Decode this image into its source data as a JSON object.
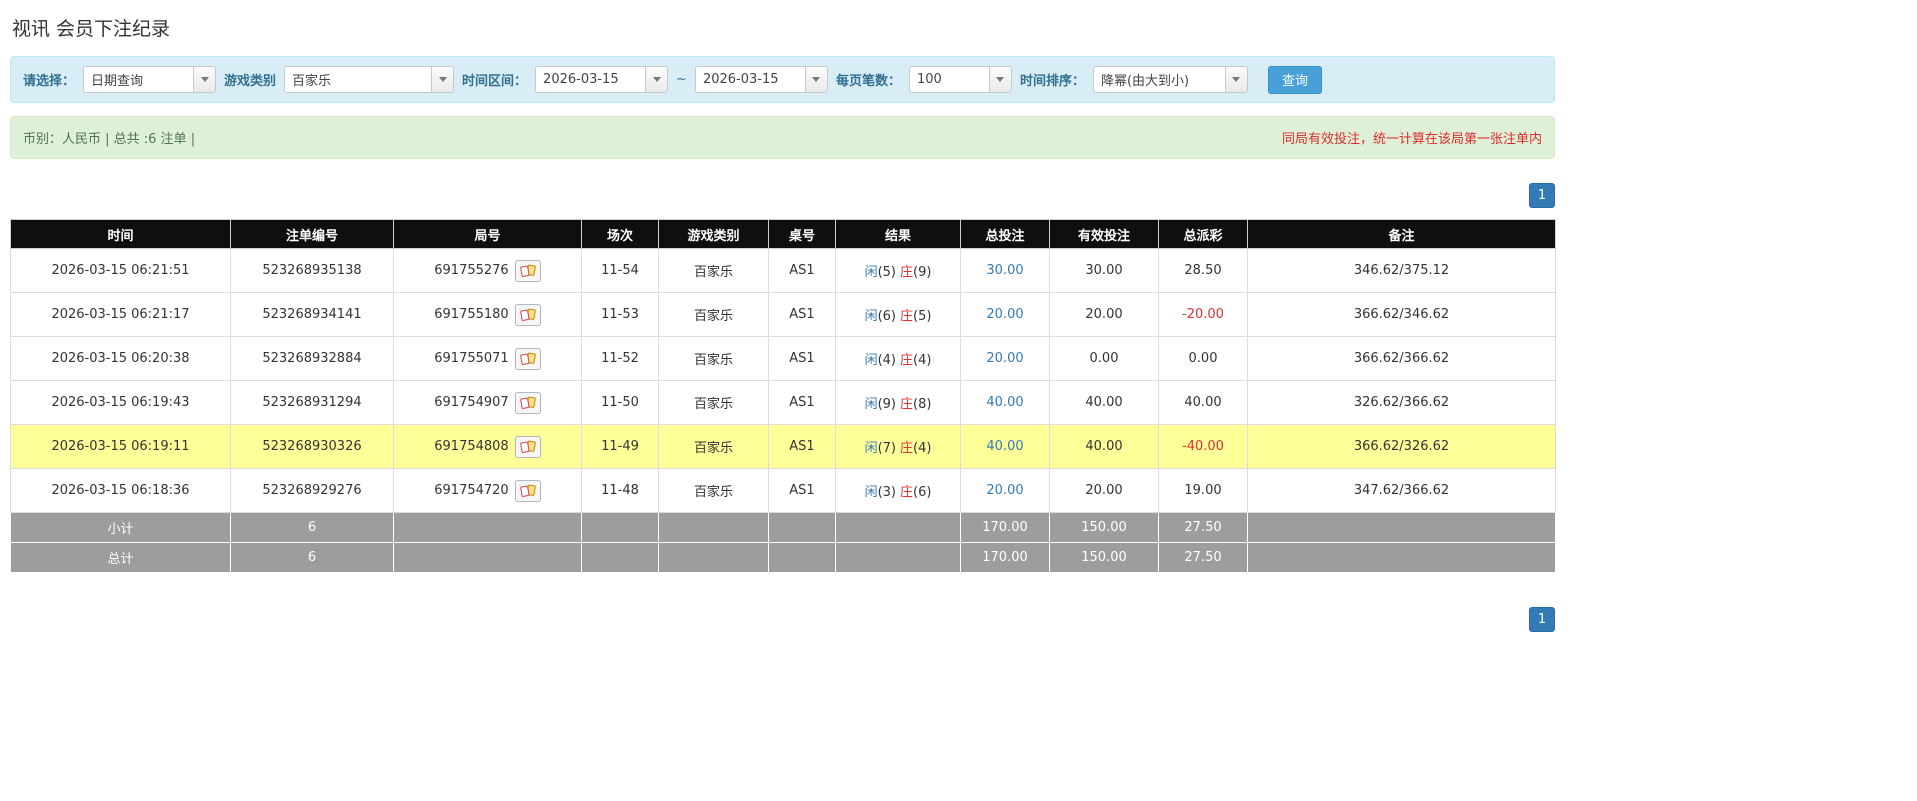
{
  "page": {
    "title": "视讯 会员下注纪录"
  },
  "filter_bar": {
    "select_label": "请选择：",
    "select_value": "日期查询",
    "game_type_label": "游戏类别",
    "game_type_value": "百家乐",
    "date_range_label": "时间区间：",
    "date_from": "2026-03-15",
    "range_separator": "~",
    "date_to": "2026-03-15",
    "page_size_label": "每页笔数：",
    "page_size_value": "100",
    "sort_label": "时间排序：",
    "sort_value": "降幂(由大到小)",
    "search_button_label": "查询"
  },
  "summary_bar": {
    "left_text": "币别：人民币 | 总共 :6 注单 |",
    "right_text": "同局有效投注，统一计算在该局第一张注单内"
  },
  "pagination": {
    "page_label": "1"
  },
  "table": {
    "headers": [
      "时间",
      "注单编号",
      "局号",
      "场次",
      "游戏类别",
      "桌号",
      "结果",
      "总投注",
      "有效投注",
      "总派彩",
      "备注"
    ],
    "rows": [
      {
        "time": "2026-03-15 06:21:51",
        "bet_id": "523268935138",
        "round": "691755276",
        "session": "11-54",
        "game": "百家乐",
        "table_no": "AS1",
        "player_label": "闲",
        "player_score": "(5)",
        "banker_label": "庄",
        "banker_score": "(9)",
        "total_bet": "30.00",
        "valid_bet": "30.00",
        "payout": "28.50",
        "payout_negative": false,
        "note": "346.62/375.12",
        "highlight": false
      },
      {
        "time": "2026-03-15 06:21:17",
        "bet_id": "523268934141",
        "round": "691755180",
        "session": "11-53",
        "game": "百家乐",
        "table_no": "AS1",
        "player_label": "闲",
        "player_score": "(6)",
        "banker_label": "庄",
        "banker_score": "(5)",
        "total_bet": "20.00",
        "valid_bet": "20.00",
        "payout": "-20.00",
        "payout_negative": true,
        "note": "366.62/346.62",
        "highlight": false
      },
      {
        "time": "2026-03-15 06:20:38",
        "bet_id": "523268932884",
        "round": "691755071",
        "session": "11-52",
        "game": "百家乐",
        "table_no": "AS1",
        "player_label": "闲",
        "player_score": "(4)",
        "banker_label": "庄",
        "banker_score": "(4)",
        "total_bet": "20.00",
        "valid_bet": "0.00",
        "payout": "0.00",
        "payout_negative": false,
        "note": "366.62/366.62",
        "highlight": false
      },
      {
        "time": "2026-03-15 06:19:43",
        "bet_id": "523268931294",
        "round": "691754907",
        "session": "11-50",
        "game": "百家乐",
        "table_no": "AS1",
        "player_label": "闲",
        "player_score": "(9)",
        "banker_label": "庄",
        "banker_score": "(8)",
        "total_bet": "40.00",
        "valid_bet": "40.00",
        "payout": "40.00",
        "payout_negative": false,
        "note": "326.62/366.62",
        "highlight": false
      },
      {
        "time": "2026-03-15 06:19:11",
        "bet_id": "523268930326",
        "round": "691754808",
        "session": "11-49",
        "game": "百家乐",
        "table_no": "AS1",
        "player_label": "闲",
        "player_score": "(7)",
        "banker_label": "庄",
        "banker_score": "(4)",
        "total_bet": "40.00",
        "valid_bet": "40.00",
        "payout": "-40.00",
        "payout_negative": true,
        "note": "366.62/326.62",
        "highlight": true
      },
      {
        "time": "2026-03-15 06:18:36",
        "bet_id": "523268929276",
        "round": "691754720",
        "session": "11-48",
        "game": "百家乐",
        "table_no": "AS1",
        "player_label": "闲",
        "player_score": "(3)",
        "banker_label": "庄",
        "banker_score": "(6)",
        "total_bet": "20.00",
        "valid_bet": "20.00",
        "payout": "19.00",
        "payout_negative": false,
        "note": "347.62/366.62",
        "highlight": false
      }
    ],
    "footer": [
      {
        "label": "小计",
        "count": "6",
        "total_bet": "170.00",
        "valid_bet": "150.00",
        "payout": "27.50"
      },
      {
        "label": "总计",
        "count": "6",
        "total_bet": "170.00",
        "valid_bet": "150.00",
        "payout": "27.50"
      }
    ]
  }
}
